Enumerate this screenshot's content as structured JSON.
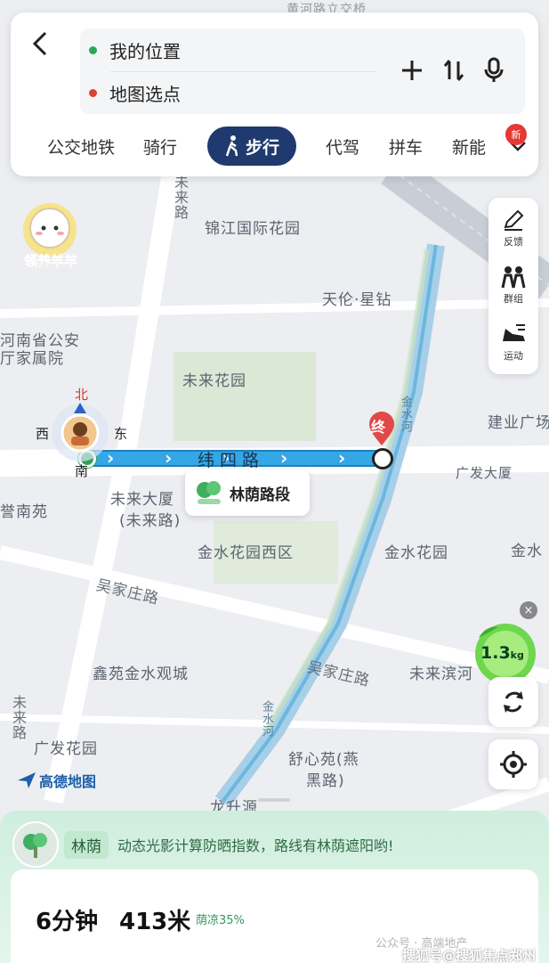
{
  "search": {
    "start_label": "我的位置",
    "end_label": "地图选点",
    "start_dot_color": "#27a85a",
    "end_dot_color": "#d9413a"
  },
  "modes": {
    "tabs": [
      "公交地铁",
      "骑行",
      "步行",
      "代驾",
      "拼车",
      "新能"
    ],
    "active": "步行",
    "new_badge": "新"
  },
  "mascot": {
    "label": "领养羊羊"
  },
  "tools": [
    {
      "label": "反馈",
      "icon": "pencil-icon"
    },
    {
      "label": "群组",
      "icon": "group-icon"
    },
    {
      "label": "运动",
      "icon": "running-shoe-icon"
    }
  ],
  "compass": {
    "north": "北",
    "south": "南",
    "east": "东",
    "west": "西"
  },
  "map_labels": {
    "jinjiang": "锦江国际花园",
    "tianlun": "天伦·星钻",
    "henan": "河南省公安",
    "henan2": "厅家属院",
    "weilai_garden": "未来花园",
    "jianye": "建业广场",
    "guangfa_tower": "广发大厦",
    "weilai_tower": "未来大厦",
    "weilai_road_paren": "(未来路)",
    "nanyuan": "誉南苑",
    "jinshui_west": "金水花园西区",
    "jinshui_garden": "金水花园",
    "jinshui_right": "金水",
    "wujiazhuang_road": "吴家庄路",
    "wujiazhuang_road2": "吴家庄路",
    "xinyuan": "鑫苑金水观城",
    "weilai_bin": "未来滨河",
    "guangfa_garden": "广发花园",
    "shuxin": "舒心苑(燕",
    "shuxin2": "黑路)",
    "longsheng": "龙升源",
    "weilai_road_v": "未来路",
    "weilai_road_v2": "未来路",
    "jinshui_river1": "金水河",
    "jinshui_river2": "金水河",
    "huanghe_bridge": "黄河路立交桥"
  },
  "route": {
    "street": "纬四路",
    "end_marker": "终",
    "shade_segment": "林荫路段",
    "route_color": "#35a6e6"
  },
  "kg_badge": {
    "value": "1.3",
    "unit": "kg",
    "close": "×"
  },
  "brand": {
    "logo": "高德地图"
  },
  "tip": {
    "tag": "林荫",
    "text": "动态光影计算防晒指数，路线有林荫遮阳哟!"
  },
  "summary": {
    "duration": "6分钟",
    "distance": "413米",
    "shade": "荫凉35%"
  },
  "watermark": {
    "line1": "公众号 · 高端地产",
    "line2": "搜狐号@搜狐焦点郑州站"
  }
}
